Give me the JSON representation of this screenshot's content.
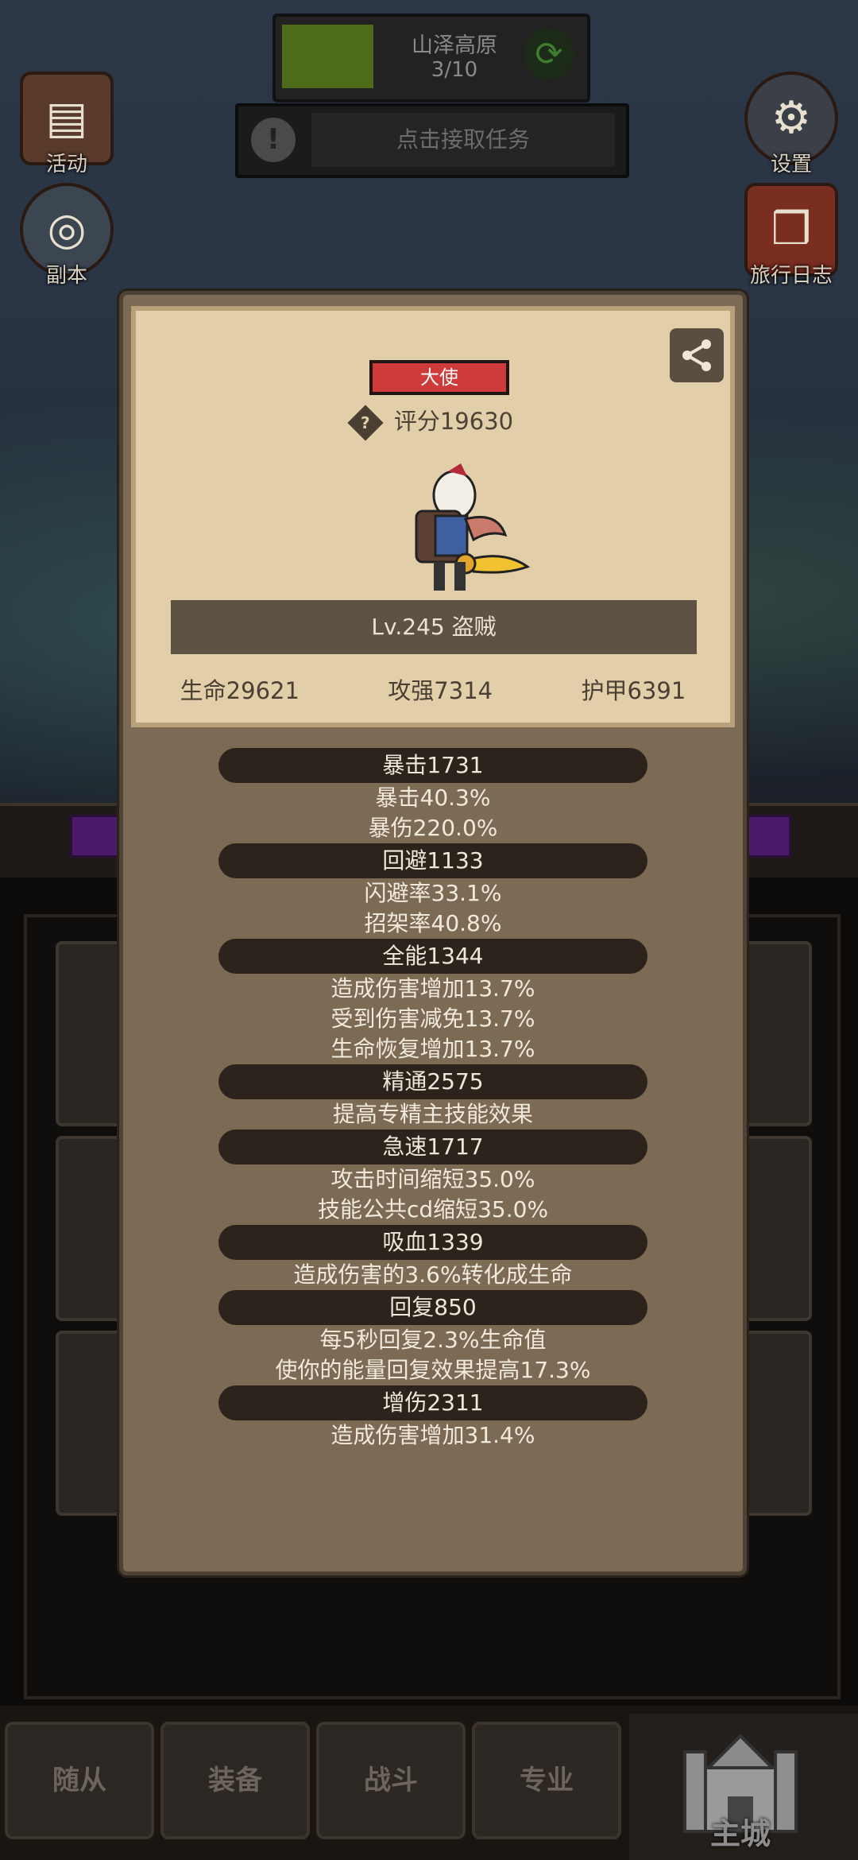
{
  "hud": {
    "stage_name": "山泽高原",
    "stage_progress": "3/10",
    "stage_progress_fraction": 0.3,
    "task_label": "点击接取任务"
  },
  "side_buttons": {
    "left": [
      {
        "label": "活动",
        "icon": "event-chest-icon"
      },
      {
        "label": "副本",
        "icon": "dungeon-portal-icon"
      }
    ],
    "right": [
      {
        "label": "设置",
        "icon": "gear-icon"
      },
      {
        "label": "旅行日志",
        "icon": "journal-book-icon"
      }
    ]
  },
  "character": {
    "rank": "大使",
    "score": "评分19630",
    "level_class": "Lv.245 盗贼",
    "hp": "生命29621",
    "attack": "攻强7314",
    "armor": "护甲6391"
  },
  "stats": [
    {
      "header": "暴击1731",
      "lines": [
        "暴击40.3%",
        "暴伤220.0%"
      ]
    },
    {
      "header": "回避1133",
      "lines": [
        "闪避率33.1%",
        "招架率40.8%"
      ]
    },
    {
      "header": "全能1344",
      "lines": [
        "造成伤害增加13.7%",
        "受到伤害减免13.7%",
        "生命恢复增加13.7%"
      ]
    },
    {
      "header": "精通2575",
      "lines": [
        "提高专精主技能效果"
      ]
    },
    {
      "header": "急速1717",
      "lines": [
        "攻击时间缩短35.0%",
        "技能公共cd缩短35.0%"
      ]
    },
    {
      "header": "吸血1339",
      "lines": [
        "造成伤害的3.6%转化成生命"
      ]
    },
    {
      "header": "回复850",
      "lines": [
        "每5秒回复2.3%生命值",
        "使你的能量回复效果提高17.3%"
      ]
    },
    {
      "header": "增伤2311",
      "lines": [
        "造成伤害增加31.4%"
      ]
    }
  ],
  "nav": {
    "tabs": [
      "随从",
      "装备",
      "战斗",
      "专业"
    ],
    "main": "主城"
  },
  "colors": {
    "rank_badge": "#cf3a3a",
    "card_bg": "#e2cfaa",
    "modal_bg": "#7c6a55",
    "stat_header_bg": "#2c241c",
    "stage_progress": "#4e6b1a"
  }
}
